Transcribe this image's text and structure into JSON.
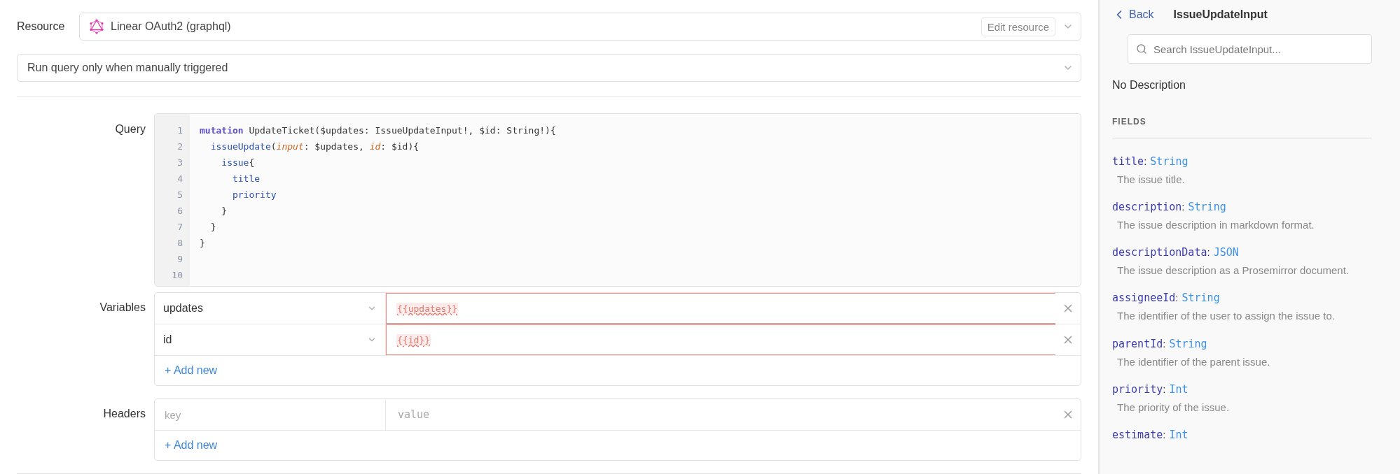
{
  "resource": {
    "label": "Resource",
    "value": "Linear OAuth2 (graphql)",
    "edit_button": "Edit resource"
  },
  "trigger": {
    "value": "Run query only when manually triggered"
  },
  "query": {
    "label": "Query",
    "lines": [
      {
        "number": "1",
        "tokens": [
          {
            "kind": "keyword",
            "text": "mutation"
          },
          {
            "kind": "plain",
            "text": " UpdateTicket($updates: IssueUpdateInput!, $id: String!){"
          }
        ]
      },
      {
        "number": "2",
        "tokens": [
          {
            "kind": "field",
            "text": "  issueUpdate"
          },
          {
            "kind": "plain",
            "text": "("
          },
          {
            "kind": "arg",
            "text": "input"
          },
          {
            "kind": "plain",
            "text": ": $updates, "
          },
          {
            "kind": "arg",
            "text": "id"
          },
          {
            "kind": "plain",
            "text": ": $id){"
          }
        ]
      },
      {
        "number": "3",
        "tokens": [
          {
            "kind": "field",
            "text": "    issue"
          },
          {
            "kind": "plain",
            "text": "{"
          }
        ]
      },
      {
        "number": "4",
        "tokens": [
          {
            "kind": "field",
            "text": "      title"
          }
        ]
      },
      {
        "number": "5",
        "tokens": [
          {
            "kind": "field",
            "text": "      priority"
          }
        ]
      },
      {
        "number": "6",
        "tokens": [
          {
            "kind": "plain",
            "text": "    }"
          }
        ]
      },
      {
        "number": "7",
        "tokens": [
          {
            "kind": "plain",
            "text": "  }"
          }
        ]
      },
      {
        "number": "8",
        "tokens": [
          {
            "kind": "plain",
            "text": "}"
          }
        ]
      },
      {
        "number": "9"
      },
      {
        "number": "10"
      }
    ]
  },
  "variables": {
    "label": "Variables",
    "rows": [
      {
        "name": "updates",
        "value": "{{updates}}",
        "error": true
      },
      {
        "name": "id",
        "value": "{{id}}",
        "error": true
      }
    ],
    "add_new": "+ Add new"
  },
  "headers": {
    "label": "Headers",
    "rows": [
      {
        "key_placeholder": "key",
        "value_placeholder": "value"
      }
    ],
    "add_new": "+ Add new"
  },
  "docs": {
    "back": "Back",
    "title": "IssueUpdateInput",
    "search": {
      "placeholder": "Search IssueUpdateInput..."
    },
    "description": "No Description",
    "section": "FIELDS",
    "fields": [
      {
        "name": "title",
        "separator": ":",
        "type": "String",
        "description": "The issue title."
      },
      {
        "name": "description",
        "separator": ":",
        "type": "String",
        "description": "The issue description in markdown format."
      },
      {
        "name": "descriptionData",
        "separator": ":",
        "type": "JSON",
        "description": "The issue description as a Prosemirror document."
      },
      {
        "name": "assigneeId",
        "separator": ":",
        "type": "String",
        "description": "The identifier of the user to assign the issue to."
      },
      {
        "name": "parentId",
        "separator": ":",
        "type": "String",
        "description": "The identifier of the parent issue."
      },
      {
        "name": "priority",
        "separator": ":",
        "type": "Int",
        "description": "The priority of the issue."
      },
      {
        "name": "estimate",
        "separator": ":",
        "type": "Int"
      }
    ]
  }
}
